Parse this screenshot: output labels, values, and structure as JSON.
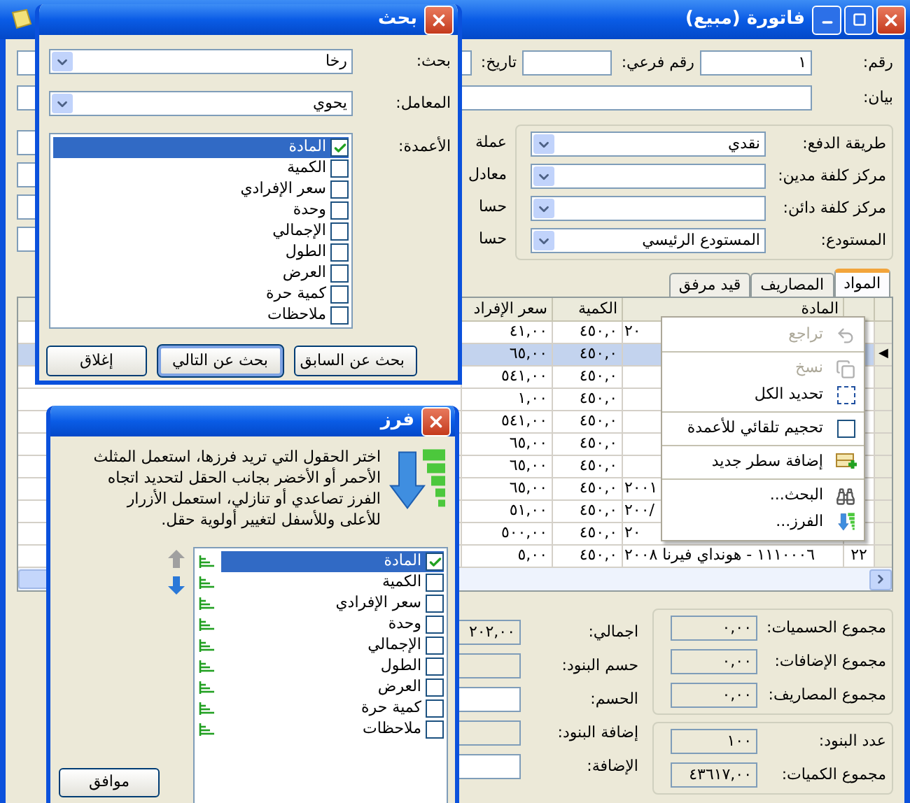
{
  "main_window": {
    "title": "فاتورة (مبيع)",
    "number": {
      "label": "رقم:",
      "value": "١"
    },
    "sub_number": {
      "label": "رقم فرعي:"
    },
    "date": {
      "label": "تاريخ:"
    },
    "statement": {
      "label": "بيان:"
    },
    "payment_group": [
      {
        "label": "طريقة الدفع:",
        "value": "نقدي"
      },
      {
        "label": "مركز كلفة مدين:"
      },
      {
        "label": "مركز كلفة دائن:"
      },
      {
        "label": "المستودع:",
        "value": "المستودع الرئيسي"
      }
    ],
    "side_labels": [
      "عملة",
      "معادل",
      "حسا",
      "حسا"
    ],
    "tabs": [
      {
        "label": "المواد",
        "selected": true
      },
      {
        "label": "المصاريف",
        "selected": false
      },
      {
        "label": "قيد مرفق",
        "selected": false
      }
    ],
    "table": {
      "columns": [
        "المادة",
        "الكمية",
        "سعر الإفراد"
      ],
      "current_marker": "◀",
      "rows": [
        {
          "selected": false,
          "material": "٢٠",
          "quantity": "٤٥٠,٠",
          "price": "٤١,٠٠"
        },
        {
          "selected": true,
          "quantity": "٤٥٠,٠",
          "price": "٦٥,٠٠"
        },
        {
          "selected": false,
          "quantity": "٤٥٠,٠",
          "price": "٥٤١,٠٠"
        },
        {
          "selected": false,
          "quantity": "٤٥٠,٠",
          "price": "١,٠٠"
        },
        {
          "selected": false,
          "quantity": "٤٥٠,٠",
          "price": "٥٤١,٠٠"
        },
        {
          "selected": false,
          "quantity": "٤٥٠,٠",
          "price": "٦٥,٠٠"
        },
        {
          "selected": false,
          "quantity": "٤٥٠,٠",
          "price": "٦٥,٠٠"
        },
        {
          "selected": false,
          "material": "٢٠٠١",
          "quantity": "٤٥٠,٠",
          "price": "٦٥,٠٠"
        },
        {
          "selected": false,
          "material": "٢٠٠/",
          "quantity": "٤٥٠,٠",
          "price": "٥١,٠٠"
        },
        {
          "selected": false,
          "material": "٢٠",
          "quantity": "٤٥٠,٠",
          "price": "٥٠٠,٠٠"
        },
        {
          "selected": false,
          "number": "٢٢",
          "material": "١١١٠٠٠٦ - هونداي فيرنا ٢٠٠٨",
          "quantity": "٤٥٠,٠",
          "price": "٥,٠٠"
        }
      ]
    },
    "totals_left": [
      {
        "label": "اجمالي:",
        "value": "٢٠٢,٠٠",
        "editable": false
      },
      {
        "label": "حسم البنود:",
        "editable": false
      },
      {
        "label": "الحسم:",
        "editable": true
      },
      {
        "label": "إضافة البنود:",
        "editable": false
      },
      {
        "label": "الإضافة:",
        "editable": true
      }
    ],
    "totals_group_1": [
      {
        "label": "مجموع الحسميات:",
        "value": "٠,٠٠"
      },
      {
        "label": "مجموع الإضافات:",
        "value": "٠,٠٠"
      },
      {
        "label": "مجموع المصاريف:",
        "value": "٠,٠٠"
      }
    ],
    "totals_group_2": [
      {
        "label": "عدد البنود:",
        "value": "١٠٠"
      },
      {
        "label": "مجموع الكميات:",
        "value": "٤٣٦١٧,٠٠"
      }
    ]
  },
  "context_menu": [
    {
      "kind": "command",
      "label": "تراجع",
      "disabled": true
    },
    {
      "kind": "separator"
    },
    {
      "kind": "command",
      "label": "نسخ",
      "disabled": true
    },
    {
      "kind": "command",
      "label": "تحديد الكل",
      "disabled": false
    },
    {
      "kind": "separator"
    },
    {
      "kind": "checkbox",
      "label": "تحجيم تلقائي للأعمدة",
      "checked": false,
      "disabled": false
    },
    {
      "kind": "separator"
    },
    {
      "kind": "command",
      "label": "إضافة سطر جديد",
      "disabled": false
    },
    {
      "kind": "separator"
    },
    {
      "kind": "command",
      "label": "البحث...",
      "disabled": false
    },
    {
      "kind": "command",
      "label": "الفرز...",
      "disabled": false
    }
  ],
  "search_dialog": {
    "title": "بحث",
    "search": {
      "label": "بحث:",
      "value": "رخا"
    },
    "operator": {
      "label": "المعامل:",
      "value": "يحوي"
    },
    "columns_label": "الأعمدة:",
    "columns": [
      {
        "label": "المادة",
        "checked": true,
        "selected": true
      },
      {
        "label": "الكمية",
        "checked": false,
        "selected": false
      },
      {
        "label": "سعر الإفرادي",
        "checked": false,
        "selected": false
      },
      {
        "label": "وحدة",
        "checked": false,
        "selected": false
      },
      {
        "label": "الإجمالي",
        "checked": false,
        "selected": false
      },
      {
        "label": "الطول",
        "checked": false,
        "selected": false
      },
      {
        "label": "العرض",
        "checked": false,
        "selected": false
      },
      {
        "label": "كمية حرة",
        "checked": false,
        "selected": false
      },
      {
        "label": "ملاحظات",
        "checked": false,
        "selected": false
      }
    ],
    "buttons": [
      {
        "label": "بحث عن السابق",
        "default": false
      },
      {
        "label": "بحث عن التالي",
        "default": true
      },
      {
        "label": "إغلاق",
        "default": false
      }
    ]
  },
  "sort_dialog": {
    "title": "فرز",
    "description": "اختر الحقول التي تريد فرزها، استعمل المثلث الأحمر أو الأخضر بجانب الحقل لتحديد اتجاه الفرز تصاعدي أو تنازلي، استعمل الأزرار للأعلى وللأسفل لتغيير أولوية حقل.",
    "move_up": {
      "disabled": true
    },
    "move_down": {
      "disabled": false
    },
    "fields": [
      {
        "label": "المادة",
        "checked": true,
        "selected": true,
        "ascending": true
      },
      {
        "label": "الكمية",
        "checked": false,
        "selected": false,
        "ascending": true
      },
      {
        "label": "سعر الإفرادي",
        "checked": false,
        "selected": false,
        "ascending": true
      },
      {
        "label": "وحدة",
        "checked": false,
        "selected": false,
        "ascending": true
      },
      {
        "label": "الإجمالي",
        "checked": false,
        "selected": false,
        "ascending": true
      },
      {
        "label": "الطول",
        "checked": false,
        "selected": false,
        "ascending": true
      },
      {
        "label": "العرض",
        "checked": false,
        "selected": false,
        "ascending": true
      },
      {
        "label": "كمية حرة",
        "checked": false,
        "selected": false,
        "ascending": true
      },
      {
        "label": "ملاحظات",
        "checked": false,
        "selected": false,
        "ascending": true
      }
    ],
    "ok_button": "موافق"
  }
}
